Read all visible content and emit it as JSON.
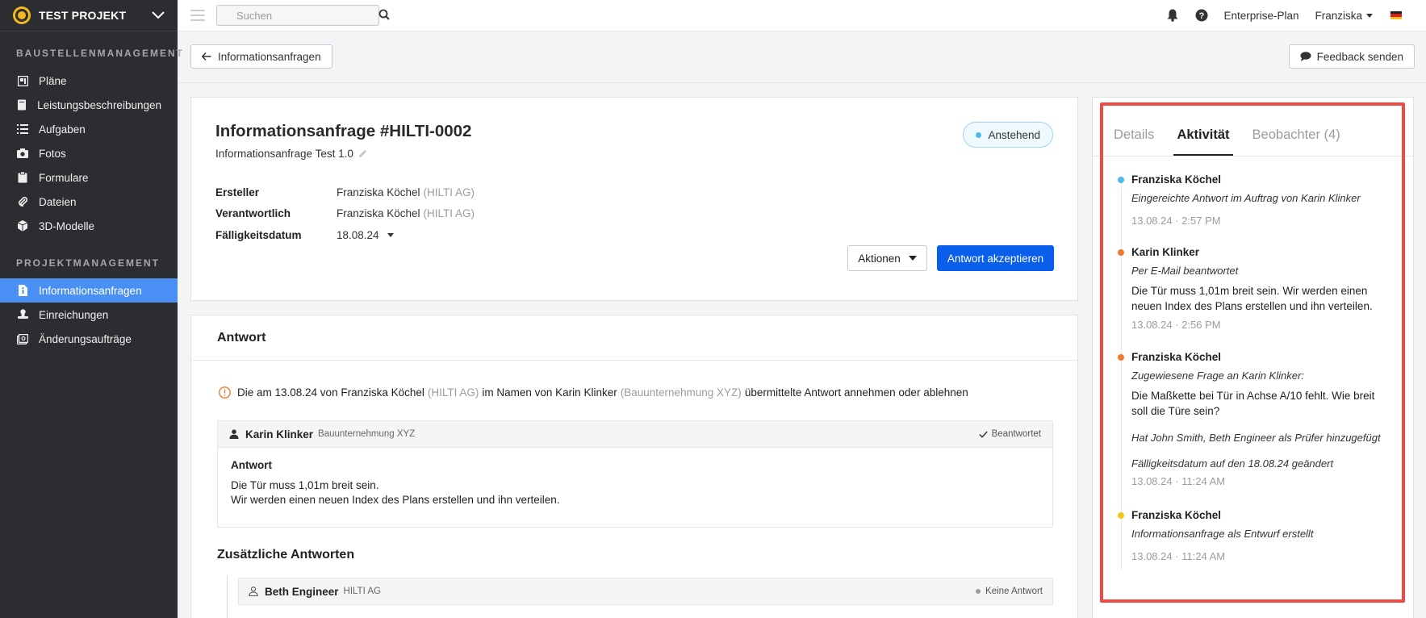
{
  "sidebar": {
    "project": "TEST PROJEKT",
    "sections": [
      {
        "title": "BAUSTELLENMANAGEMENT",
        "items": [
          {
            "label": "Pläne",
            "icon": "plans-icon"
          },
          {
            "label": "Leistungsbeschreibungen",
            "icon": "book-icon"
          },
          {
            "label": "Aufgaben",
            "icon": "list-icon"
          },
          {
            "label": "Fotos",
            "icon": "camera-icon"
          },
          {
            "label": "Formulare",
            "icon": "clipboard-icon"
          },
          {
            "label": "Dateien",
            "icon": "paperclip-icon"
          },
          {
            "label": "3D-Modelle",
            "icon": "cube-icon"
          }
        ]
      },
      {
        "title": "PROJEKTMANAGEMENT",
        "items": [
          {
            "label": "Informationsanfragen",
            "icon": "info-doc-icon",
            "active": true
          },
          {
            "label": "Einreichungen",
            "icon": "stamp-icon"
          },
          {
            "label": "Änderungsaufträge",
            "icon": "change-order-icon"
          }
        ]
      }
    ]
  },
  "topbar": {
    "search_placeholder": "Suchen",
    "plan": "Enterprise-Plan",
    "user": "Franziska"
  },
  "back_label": "Informationsanfragen",
  "feedback_label": "Feedback senden",
  "rfi": {
    "title": "Informationsanfrage #HILTI-0002",
    "subtitle": "Informationsanfrage Test 1.0",
    "status": "Anstehend",
    "fields": {
      "creator_label": "Ersteller",
      "creator_name": "Franziska Köchel",
      "creator_org": "(HILTI AG)",
      "responsible_label": "Verantwortlich",
      "responsible_name": "Franziska Köchel",
      "responsible_org": "(HILTI AG)",
      "due_label": "Fälligkeitsdatum",
      "due_value": "18.08.24"
    },
    "actions_label": "Aktionen",
    "accept_label": "Antwort akzeptieren"
  },
  "answer": {
    "heading": "Antwort",
    "notice": {
      "p1": "Die am 13.08.24 von Franziska Köchel",
      "org1": "(HILTI AG)",
      "p2": "im Namen von Karin Klinker",
      "org2": "(Bauunternehmung XYZ)",
      "p3": "übermittelte Antwort annehmen oder ablehnen"
    },
    "response": {
      "name": "Karin Klinker",
      "company": "Bauunternehmung XYZ",
      "state": "Beantwortet",
      "label": "Antwort",
      "line1": "Die Tür muss 1,01m breit sein.",
      "line2": "Wir werden einen neuen Index des Plans erstellen und ihn verteilen."
    },
    "more_title": "Zusätzliche Antworten",
    "more": {
      "name": "Beth Engineer",
      "company": "HILTI AG",
      "state": "Keine Antwort"
    }
  },
  "side": {
    "tabs": [
      "Details",
      "Aktivität",
      "Beobachter (4)"
    ],
    "activity": [
      {
        "name": "Franziska Köchel",
        "action": "Eingereichte Antwort im Auftrag von Karin Klinker",
        "time": "13.08.24 · 2:57 PM",
        "color": "#4bbbeb"
      },
      {
        "name": "Karin Klinker",
        "action": "Per E-Mail beantwortet",
        "text": "Die Tür muss 1,01m breit sein. Wir werden einen neuen Index des Plans erstellen und ihn verteilen.",
        "time": "13.08.24 · 2:56 PM",
        "color": "#f07a32"
      },
      {
        "name": "Franziska Köchel",
        "action": "Zugewiesene Frage an Karin Klinker:",
        "text": "Die Maßkette bei Tür in Achse A/10 fehlt. Wie breit soll die Türe sein?",
        "extra1": "Hat John Smith, Beth Engineer als Prüfer hinzugefügt",
        "extra2": "Fälligkeitsdatum auf den 18.08.24 geändert",
        "time": "13.08.24 · 11:24 AM",
        "color": "#f07a32"
      },
      {
        "name": "Franziska Köchel",
        "action": "Informationsanfrage als Entwurf erstellt",
        "time": "13.08.24 · 11:24 AM",
        "color": "#f5c518"
      }
    ]
  }
}
